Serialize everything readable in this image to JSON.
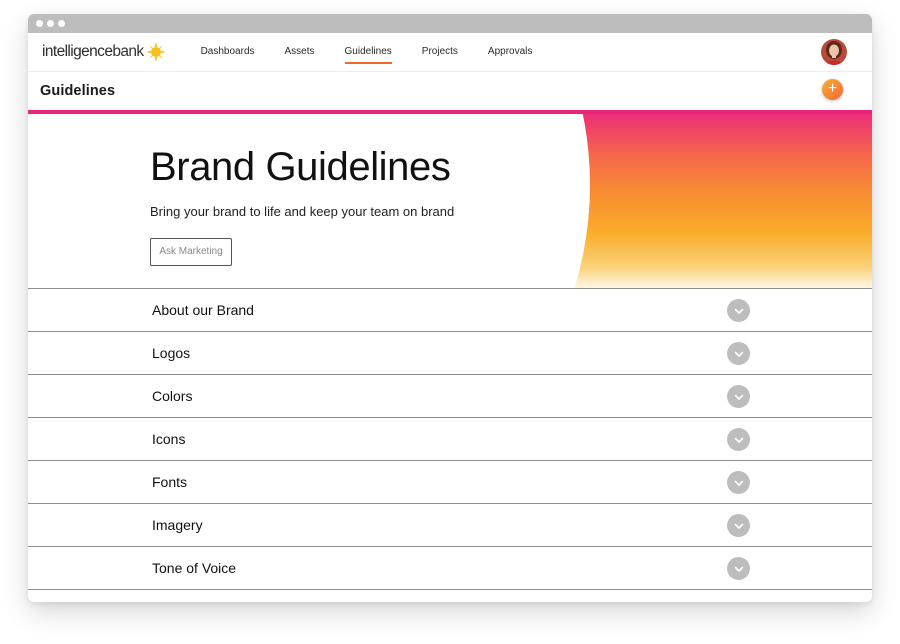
{
  "browser": {
    "controls": [
      "close",
      "minimize",
      "maximize"
    ]
  },
  "brand": {
    "logo_text_a": "intelligence",
    "logo_text_b": "bank",
    "accent": "#f26a2a",
    "highlight": "#e8247d"
  },
  "nav": {
    "items": [
      {
        "label": "Dashboards",
        "active": false
      },
      {
        "label": "Assets",
        "active": false
      },
      {
        "label": "Guidelines",
        "active": true
      },
      {
        "label": "Projects",
        "active": false
      },
      {
        "label": "Approvals",
        "active": false
      }
    ]
  },
  "subheader": {
    "title": "Guidelines",
    "add_icon": "+"
  },
  "hero": {
    "title": "Brand Guidelines",
    "subtitle": "Bring your brand to life and keep your team on brand",
    "button_label": "Ask Marketing"
  },
  "sections": [
    {
      "label": "About our Brand"
    },
    {
      "label": "Logos"
    },
    {
      "label": "Colors"
    },
    {
      "label": "Icons"
    },
    {
      "label": "Fonts"
    },
    {
      "label": "Imagery"
    },
    {
      "label": "Tone of Voice"
    }
  ]
}
